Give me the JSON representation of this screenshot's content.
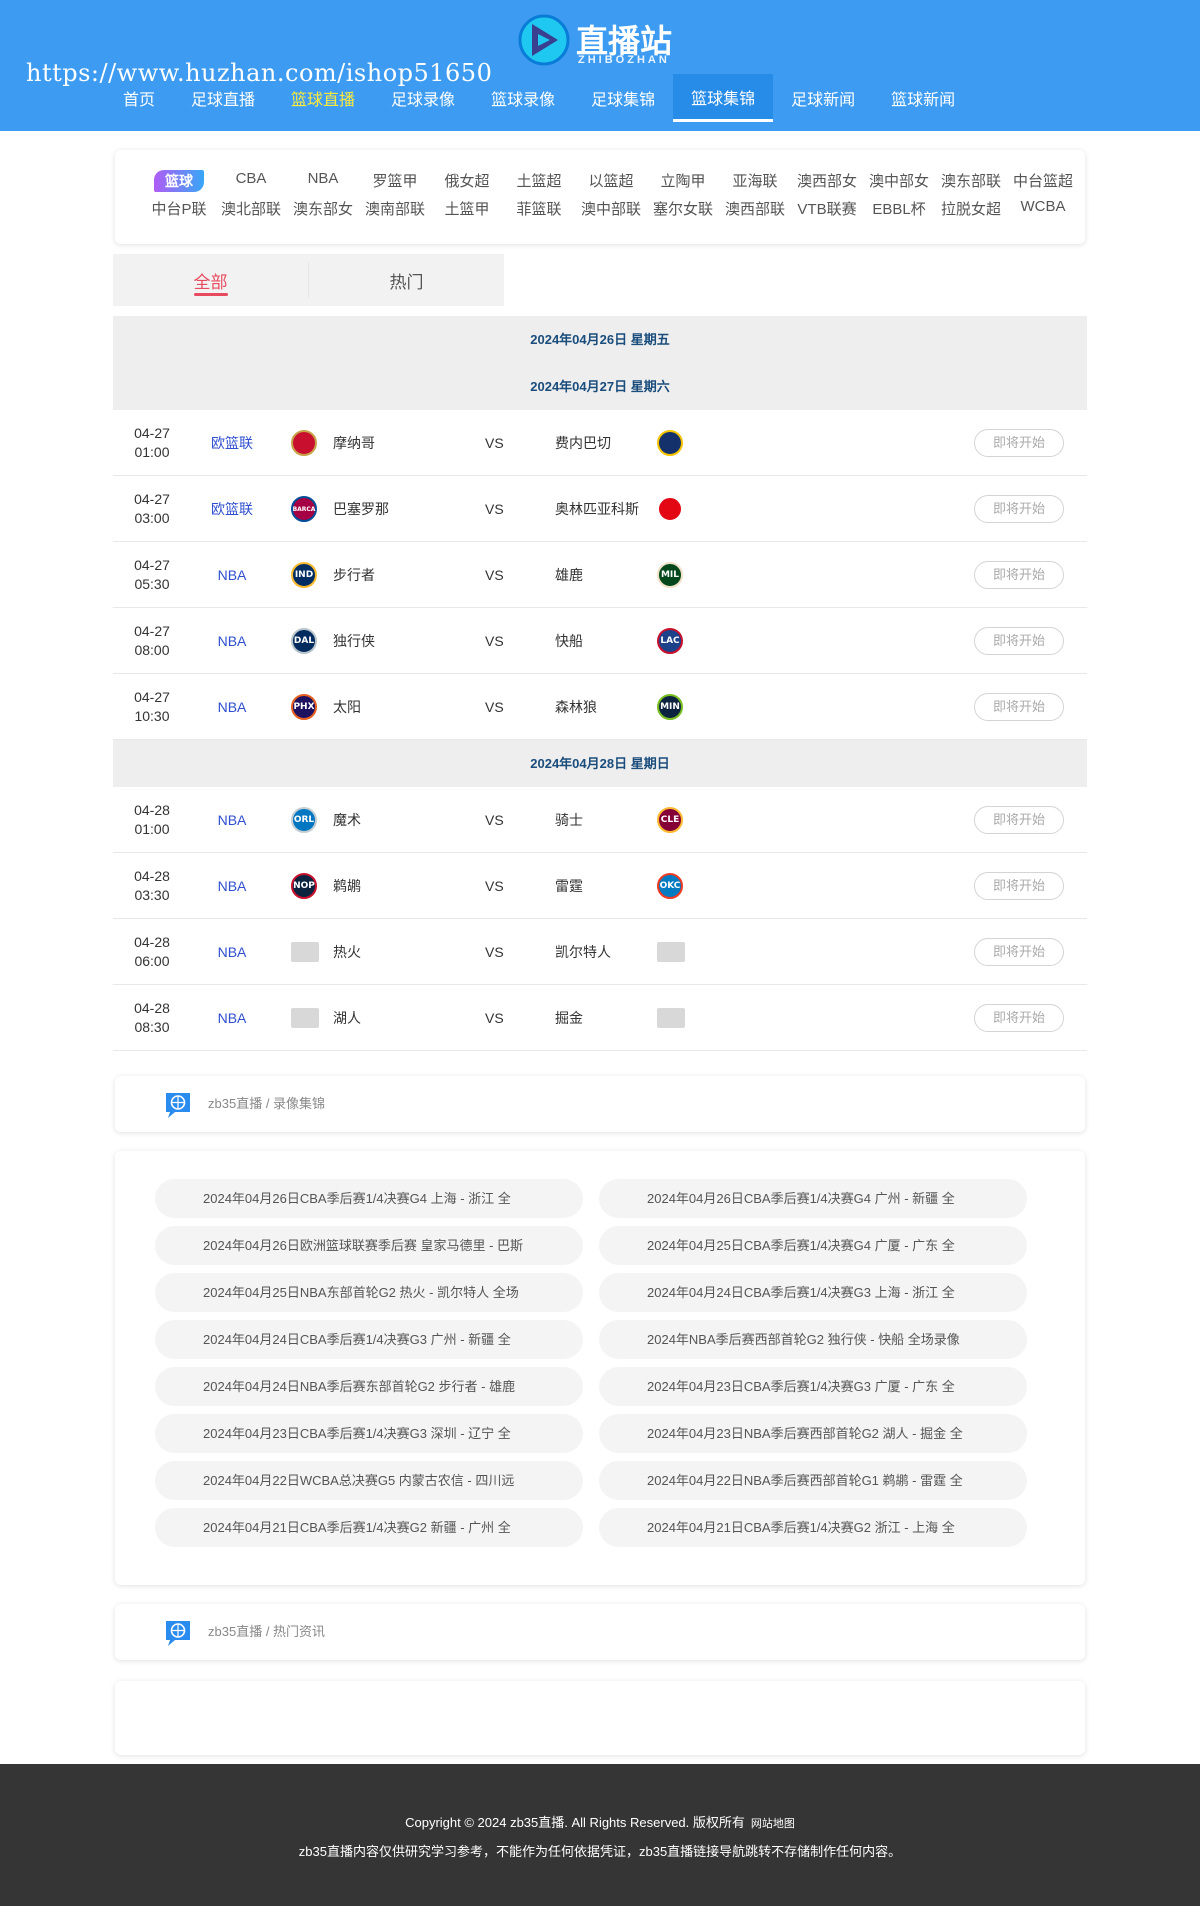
{
  "header": {
    "logo_title": "直播站",
    "logo_sub": "ZHIBOZHAN",
    "watermark": "https://www.huzhan.com/ishop51650",
    "nav": [
      {
        "label": "首页",
        "state": "normal"
      },
      {
        "label": "足球直播",
        "state": "normal"
      },
      {
        "label": "篮球直播",
        "state": "highlight"
      },
      {
        "label": "足球录像",
        "state": "normal"
      },
      {
        "label": "篮球录像",
        "state": "normal"
      },
      {
        "label": "足球集锦",
        "state": "normal"
      },
      {
        "label": "篮球集锦",
        "state": "active"
      },
      {
        "label": "足球新闻",
        "state": "normal"
      },
      {
        "label": "篮球新闻",
        "state": "normal"
      }
    ]
  },
  "leagues": [
    "篮球",
    "CBA",
    "NBA",
    "罗篮甲",
    "俄女超",
    "土篮超",
    "以篮超",
    "立陶甲",
    "亚海联",
    "澳西部女",
    "澳中部女",
    "澳东部联",
    "中台篮超",
    "中台P联",
    "澳北部联",
    "澳东部女",
    "澳南部联",
    "土篮甲",
    "菲篮联",
    "澳中部联",
    "塞尔女联",
    "澳西部联",
    "VTB联赛",
    "EBBL杯",
    "拉脱女超",
    "WCBA"
  ],
  "tabs": [
    "全部",
    "热门"
  ],
  "schedule": [
    {
      "date": "2024年04月26日 星期五",
      "matches": []
    },
    {
      "date": "2024年04月27日 星期六",
      "matches": [
        {
          "date": "04-27",
          "time": "01:00",
          "league": "欧篮联",
          "home": "摩纳哥",
          "vs": "VS",
          "away": "费内巴切",
          "status": "即将开始",
          "home_logo": {
            "text": "",
            "color": "#c8102e",
            "ring": "#c8a24a"
          },
          "away_logo": {
            "text": "",
            "color": "#14316b",
            "ring": "#f5c400"
          }
        },
        {
          "date": "04-27",
          "time": "03:00",
          "league": "欧篮联",
          "home": "巴塞罗那",
          "vs": "VS",
          "away": "奥林匹亚科斯",
          "status": "即将开始",
          "home_logo": {
            "text": "BARCA",
            "color": "#a50044",
            "ring": "#004d98"
          },
          "away_logo": {
            "text": "",
            "color": "#e30613",
            "ring": "#ffffff"
          }
        },
        {
          "date": "04-27",
          "time": "05:30",
          "league": "NBA",
          "home": "步行者",
          "vs": "VS",
          "away": "雄鹿",
          "status": "即将开始",
          "home_logo": {
            "text": "IND",
            "color": "#002d62",
            "ring": "#fdbb30"
          },
          "away_logo": {
            "text": "MIL",
            "color": "#00471b",
            "ring": "#eee1c6"
          }
        },
        {
          "date": "04-27",
          "time": "08:00",
          "league": "NBA",
          "home": "独行侠",
          "vs": "VS",
          "away": "快船",
          "status": "即将开始",
          "home_logo": {
            "text": "DAL",
            "color": "#002b5e",
            "ring": "#b8c4ca"
          },
          "away_logo": {
            "text": "LAC",
            "color": "#1d428a",
            "ring": "#c8102e"
          }
        },
        {
          "date": "04-27",
          "time": "10:30",
          "league": "NBA",
          "home": "太阳",
          "vs": "VS",
          "away": "森林狼",
          "status": "即将开始",
          "home_logo": {
            "text": "PHX",
            "color": "#1d1160",
            "ring": "#e56020"
          },
          "away_logo": {
            "text": "MIN",
            "color": "#0c2340",
            "ring": "#78be20"
          }
        }
      ]
    },
    {
      "date": "2024年04月28日 星期日",
      "matches": [
        {
          "date": "04-28",
          "time": "01:00",
          "league": "NBA",
          "home": "魔术",
          "vs": "VS",
          "away": "骑士",
          "status": "即将开始",
          "home_logo": {
            "text": "ORL",
            "color": "#0077c0",
            "ring": "#c4ced4"
          },
          "away_logo": {
            "text": "CLE",
            "color": "#860038",
            "ring": "#fdbb30"
          }
        },
        {
          "date": "04-28",
          "time": "03:30",
          "league": "NBA",
          "home": "鹈鹕",
          "vs": "VS",
          "away": "雷霆",
          "status": "即将开始",
          "home_logo": {
            "text": "NOP",
            "color": "#0c2340",
            "ring": "#c8102e"
          },
          "away_logo": {
            "text": "OKC",
            "color": "#007ac1",
            "ring": "#ef3b24"
          }
        },
        {
          "date": "04-28",
          "time": "06:00",
          "league": "NBA",
          "home": "热火",
          "vs": "VS",
          "away": "凯尔特人",
          "status": "即将开始",
          "home_logo": {
            "text": "",
            "color": "placeholder",
            "ring": ""
          },
          "away_logo": {
            "text": "",
            "color": "placeholder",
            "ring": ""
          }
        },
        {
          "date": "04-28",
          "time": "08:30",
          "league": "NBA",
          "home": "湖人",
          "vs": "VS",
          "away": "掘金",
          "status": "即将开始",
          "home_logo": {
            "text": "",
            "color": "placeholder",
            "ring": ""
          },
          "away_logo": {
            "text": "",
            "color": "placeholder",
            "ring": ""
          }
        }
      ]
    }
  ],
  "section_recordings": {
    "site": "zb35直播",
    "sep": " / ",
    "label": "录像集锦",
    "icon": "basketball-chat-icon"
  },
  "recordings": [
    "2024年04月26日CBA季后赛1/4决赛G4 上海 - 浙江 全",
    "2024年04月26日CBA季后赛1/4决赛G4 广州 - 新疆 全",
    "2024年04月26日欧洲篮球联赛季后赛 皇家马德里 - 巴斯",
    "2024年04月25日CBA季后赛1/4决赛G4 广厦 - 广东 全",
    "2024年04月25日NBA东部首轮G2 热火 - 凯尔特人 全场",
    "2024年04月24日CBA季后赛1/4决赛G3 上海 - 浙江 全",
    "2024年04月24日CBA季后赛1/4决赛G3 广州 - 新疆 全",
    "2024年NBA季后赛西部首轮G2 独行侠 - 快船 全场录像",
    "2024年04月24日NBA季后赛东部首轮G2 步行者 - 雄鹿",
    "2024年04月23日CBA季后赛1/4决赛G3 广厦 - 广东 全",
    "2024年04月23日CBA季后赛1/4决赛G3 深圳 - 辽宁 全",
    "2024年04月23日NBA季后赛西部首轮G2 湖人 - 掘金 全",
    "2024年04月22日WCBA总决赛G5 内蒙古农信 - 四川远",
    "2024年04月22日NBA季后赛西部首轮G1 鹈鹕 - 雷霆 全",
    "2024年04月21日CBA季后赛1/4决赛G2 新疆 - 广州 全",
    "2024年04月21日CBA季后赛1/4决赛G2 浙江 - 上海 全"
  ],
  "section_news": {
    "site": "zb35直播",
    "sep": " / ",
    "label": "热门资讯",
    "icon": "basketball-chat-icon"
  },
  "footer": {
    "copyright": "Copyright © 2024 zb35直播. All Rights Reserved. 版权所有",
    "sitemap": "网站地图",
    "disclaimer": "zb35直播内容仅供研究学习参考，不能作为任何依据凭证，zb35直播链接导航跳转不存储制作任何内容。"
  },
  "colors": {
    "header_bg": "#3d9cf2",
    "accent_red": "#e84a5f",
    "league_link": "#2f4fcf",
    "footer_bg": "#353535"
  }
}
